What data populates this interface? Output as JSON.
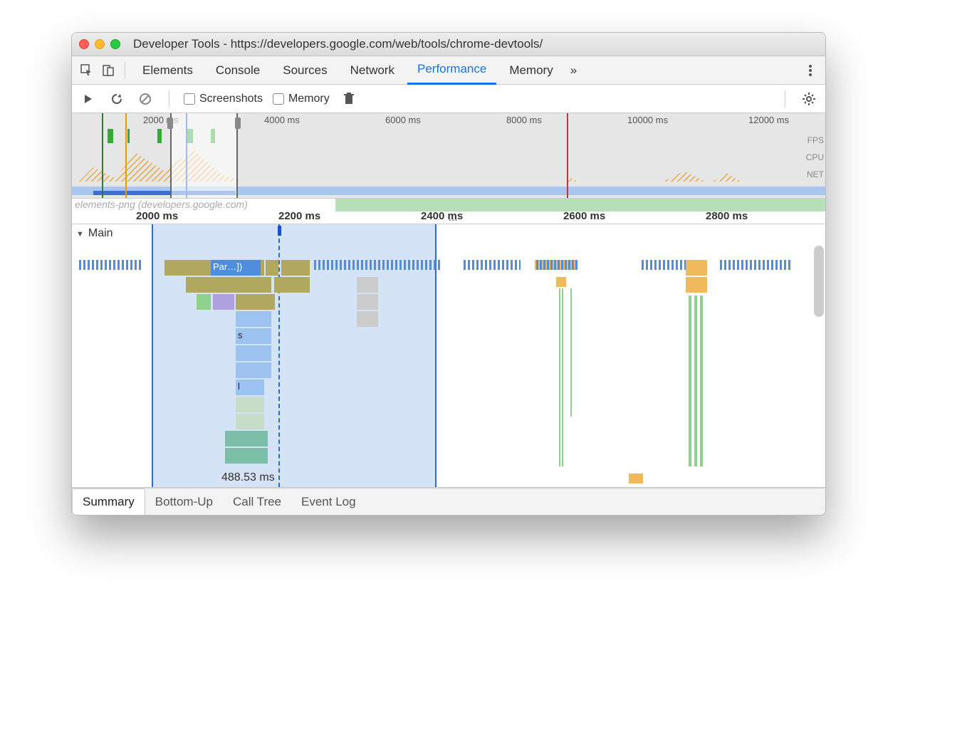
{
  "window": {
    "title": "Developer Tools - https://developers.google.com/web/tools/chrome-devtools/"
  },
  "tabs": {
    "elements": "Elements",
    "console": "Console",
    "sources": "Sources",
    "network": "Network",
    "performance": "Performance",
    "memory": "Memory",
    "overflow": "»"
  },
  "perf_toolbar": {
    "screenshots": "Screenshots",
    "memory": "Memory"
  },
  "overview": {
    "ticks": [
      "2000 ms",
      "4000 ms",
      "6000 ms",
      "8000 ms",
      "10000 ms",
      "12000 ms"
    ],
    "side_labels": [
      "FPS",
      "CPU",
      "NET"
    ]
  },
  "ruler2": {
    "ghost": "elements-png (developers.google.com)",
    "ticks": [
      "2000 ms",
      "2200 ms",
      "2400 ms",
      "2600 ms",
      "2800 ms"
    ],
    "dots": "..."
  },
  "main": {
    "label": "Main",
    "parse_label": "Par…])",
    "s_label": "s",
    "l_label": "l",
    "selection_time": "488.53 ms"
  },
  "bottom_tabs": {
    "summary": "Summary",
    "bottom_up": "Bottom-Up",
    "call_tree": "Call Tree",
    "event_log": "Event Log"
  },
  "colors": {
    "blue": "#4f8de0",
    "olive": "#b0a85e",
    "teal": "#7bbfa8",
    "lightblue": "#9cc2f0",
    "orange": "#f0b95c",
    "green": "#8fd08f",
    "purple": "#b0a0e0"
  }
}
